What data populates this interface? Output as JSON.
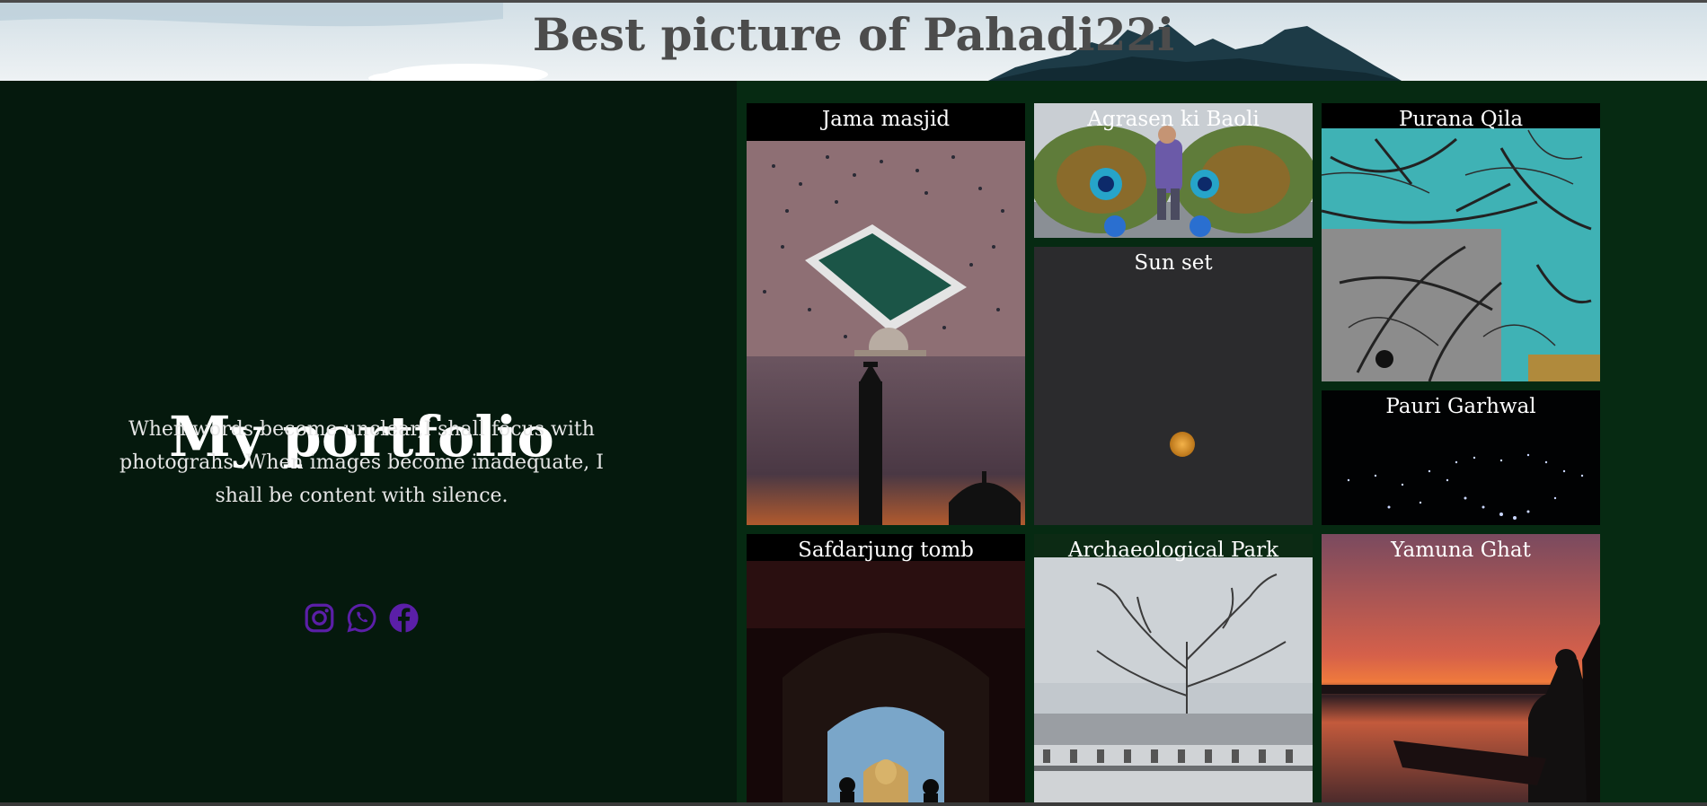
{
  "header": {
    "title": "Best picture of Pahadi22i"
  },
  "intro": {
    "title": "My portfolio",
    "tagline": "When words become unclear,I shall focus with photograhs .When images become inadequate, I shall be content with silence."
  },
  "social": [
    {
      "icon": "instagram-icon",
      "color": "#5b1fa8"
    },
    {
      "icon": "whatsapp-icon",
      "color": "#5b1fa8"
    },
    {
      "icon": "facebook-icon",
      "color": "#5b1fa8"
    }
  ],
  "gallery": [
    {
      "caption": "Jama masjid"
    },
    {
      "caption": "Agrasen ki Baoli"
    },
    {
      "caption": "Purana Qila"
    },
    {
      "caption": "Sun set"
    },
    {
      "caption": "Pauri Garhwal"
    },
    {
      "caption": "Safdarjung tomb"
    },
    {
      "caption": "Archaeological Park"
    },
    {
      "caption": "Yamuna Ghat"
    }
  ],
  "colors": {
    "background": "#062a12",
    "panel": "#05190d",
    "accent": "#5b1fa8"
  }
}
